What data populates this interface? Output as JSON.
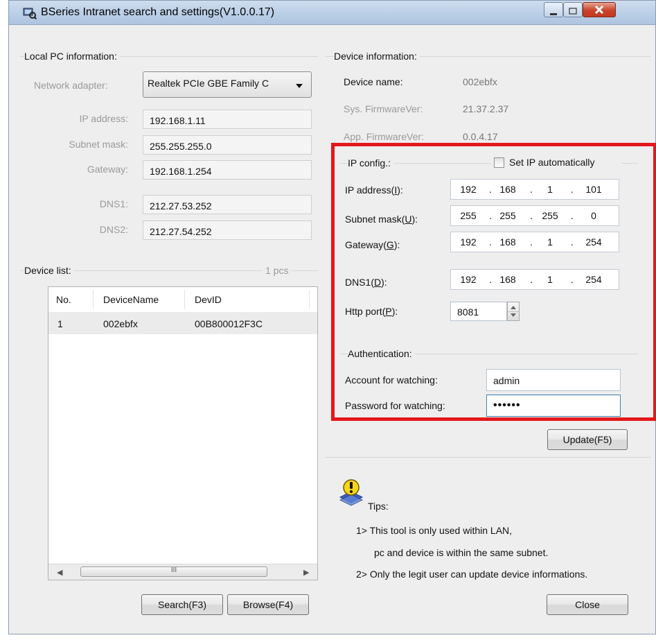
{
  "window": {
    "title": "BSeries Intranet search and settings(V1.0.0.17)",
    "icon": "app-search-icon"
  },
  "local_pc": {
    "group_label": "Local PC information:",
    "adapter_label": "Network adapter:",
    "adapter_value": "Realtek PCIe GBE Family C",
    "ip_label": "IP address:",
    "ip_value": "192.168.1.11",
    "mask_label": "Subnet mask:",
    "mask_value": "255.255.255.0",
    "gateway_label": "Gateway:",
    "gateway_value": "192.168.1.254",
    "dns1_label": "DNS1:",
    "dns1_value": "212.27.53.252",
    "dns2_label": "DNS2:",
    "dns2_value": "212.27.54.252"
  },
  "device_list": {
    "group_label": "Device list:",
    "count": "1 pcs",
    "columns": [
      "No.",
      "DeviceName",
      "DevID"
    ],
    "rows": [
      [
        "1",
        "002ebfx",
        "00B800012F3C"
      ]
    ],
    "scroll_grip": "III"
  },
  "device_info": {
    "group_label": "Device information:",
    "name_label": "Device name:",
    "name_value": "002ebfx",
    "sysfw_label": "Sys. FirmwareVer:",
    "sysfw_value": "21.37.2.37",
    "appfw_label": "App. FirmwareVer:",
    "appfw_value": "0.0.4.17"
  },
  "ip_config": {
    "group_label": "IP config.:",
    "auto_label": "Set IP automatically",
    "auto_checked": false,
    "ip_label_pre": "IP address(",
    "ip_label_key": "I",
    "ip_octets": [
      "192",
      "168",
      "1",
      "101"
    ],
    "mask_label_pre": "Subnet mask(",
    "mask_label_key": "U",
    "mask_octets": [
      "255",
      "255",
      "255",
      "0"
    ],
    "gw_label_pre": "Gateway(",
    "gw_label_key": "G",
    "gw_octets": [
      "192",
      "168",
      "1",
      "254"
    ],
    "dns_label_pre": "DNS1(",
    "dns_label_key": "D",
    "dns_octets": [
      "192",
      "168",
      "1",
      "254"
    ],
    "port_label_pre": "Http port(",
    "port_label_key": "P",
    "port_value": "8081",
    "label_close": "):",
    "dot": "."
  },
  "auth": {
    "group_label": "Authentication:",
    "account_label": "Account for watching:",
    "account_value": "admin",
    "password_label": "Password for watching:",
    "password_value": "••••••"
  },
  "buttons": {
    "update": "Update(F5)",
    "search": "Search(F3)",
    "browse": "Browse(F4)",
    "close": "Close"
  },
  "tips": {
    "title": "Tips:",
    "line1": "1> This tool is only used within LAN,",
    "line2": "pc and device is within the same subnet.",
    "line3": "2> Only the legit user can update  device informations."
  },
  "colors": {
    "highlight_box": "#e3181c",
    "window_bg": "#eeeeee"
  }
}
